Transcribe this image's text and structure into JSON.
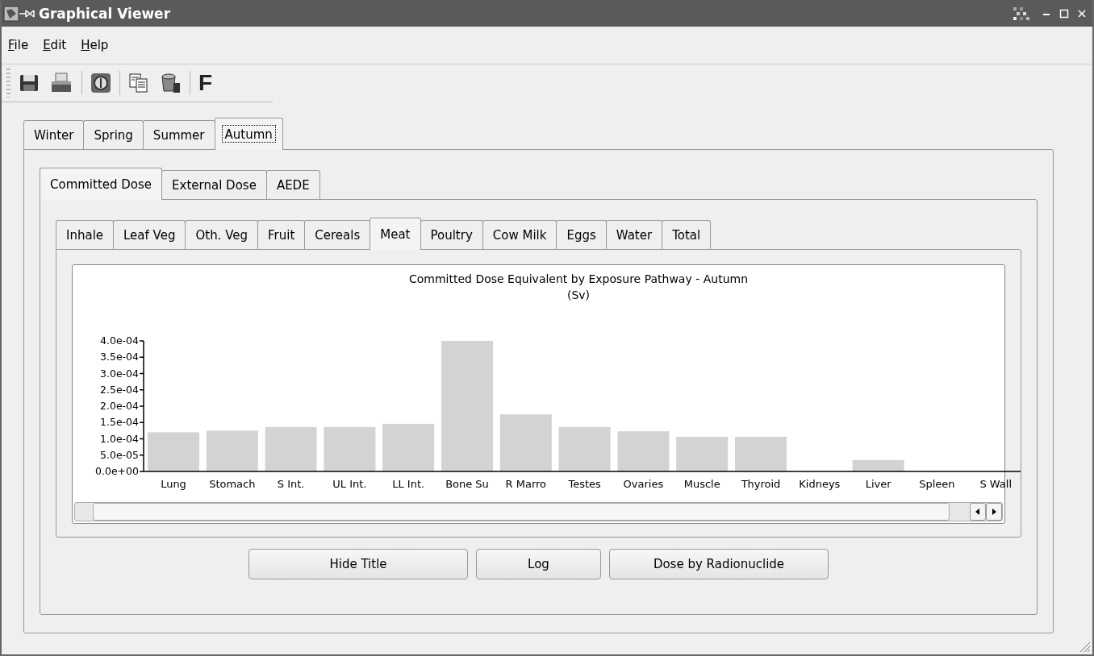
{
  "window": {
    "title": "Graphical Viewer"
  },
  "menu": [
    "File",
    "Edit",
    "Help"
  ],
  "toolbar": {
    "text_button": "F"
  },
  "season_tabs": [
    {
      "label": "Winter",
      "selected": false
    },
    {
      "label": "Spring",
      "selected": false
    },
    {
      "label": "Summer",
      "selected": false
    },
    {
      "label": "Autumn",
      "selected": true
    }
  ],
  "dose_tabs": [
    {
      "label": "Committed Dose",
      "selected": true
    },
    {
      "label": "External Dose",
      "selected": false
    },
    {
      "label": "AEDE",
      "selected": false
    }
  ],
  "pathway_tabs": [
    {
      "label": "Inhale",
      "selected": false
    },
    {
      "label": "Leaf Veg",
      "selected": false
    },
    {
      "label": "Oth. Veg",
      "selected": false
    },
    {
      "label": "Fruit",
      "selected": false
    },
    {
      "label": "Cereals",
      "selected": false
    },
    {
      "label": "Meat",
      "selected": true
    },
    {
      "label": "Poultry",
      "selected": false
    },
    {
      "label": "Cow Milk",
      "selected": false
    },
    {
      "label": "Eggs",
      "selected": false
    },
    {
      "label": "Water",
      "selected": false
    },
    {
      "label": "Total",
      "selected": false
    }
  ],
  "chart_data": {
    "type": "bar",
    "title": "Committed Dose Equivalent by Exposure Pathway - Autumn",
    "ylabel": "(Sv)",
    "categories": [
      "Lung",
      "Stomach",
      "S Int.",
      "UL Int.",
      "LL Int.",
      "Bone Su",
      "R Marro",
      "Testes",
      "Ovaries",
      "Muscle",
      "Thyroid",
      "Kidneys",
      "Liver",
      "Spleen",
      "S Wall"
    ],
    "series": [
      {
        "color": "#d3d3d3",
        "values": [
          0.00012,
          0.000125,
          0.000136,
          0.000136,
          0.000146,
          0.0004,
          0.000175,
          0.000136,
          0.000123,
          0.000106,
          0.000106,
          0,
          3.5e-05,
          0,
          0
        ]
      }
    ],
    "ylim": [
      0,
      0.0004
    ],
    "yticks": [
      {
        "value": 0,
        "label": "0.0e+00"
      },
      {
        "value": 5e-05,
        "label": "5.0e-05"
      },
      {
        "value": 0.0001,
        "label": "1.0e-04"
      },
      {
        "value": 0.00015,
        "label": "1.5e-04"
      },
      {
        "value": 0.0002,
        "label": "2.0e-04"
      },
      {
        "value": 0.00025,
        "label": "2.5e-04"
      },
      {
        "value": 0.0003,
        "label": "3.0e-04"
      },
      {
        "value": 0.00035,
        "label": "3.5e-04"
      },
      {
        "value": 0.0004,
        "label": "4.0e-04"
      }
    ]
  },
  "buttons": [
    "Hide Title",
    "Log",
    "Dose by Radionuclide"
  ]
}
